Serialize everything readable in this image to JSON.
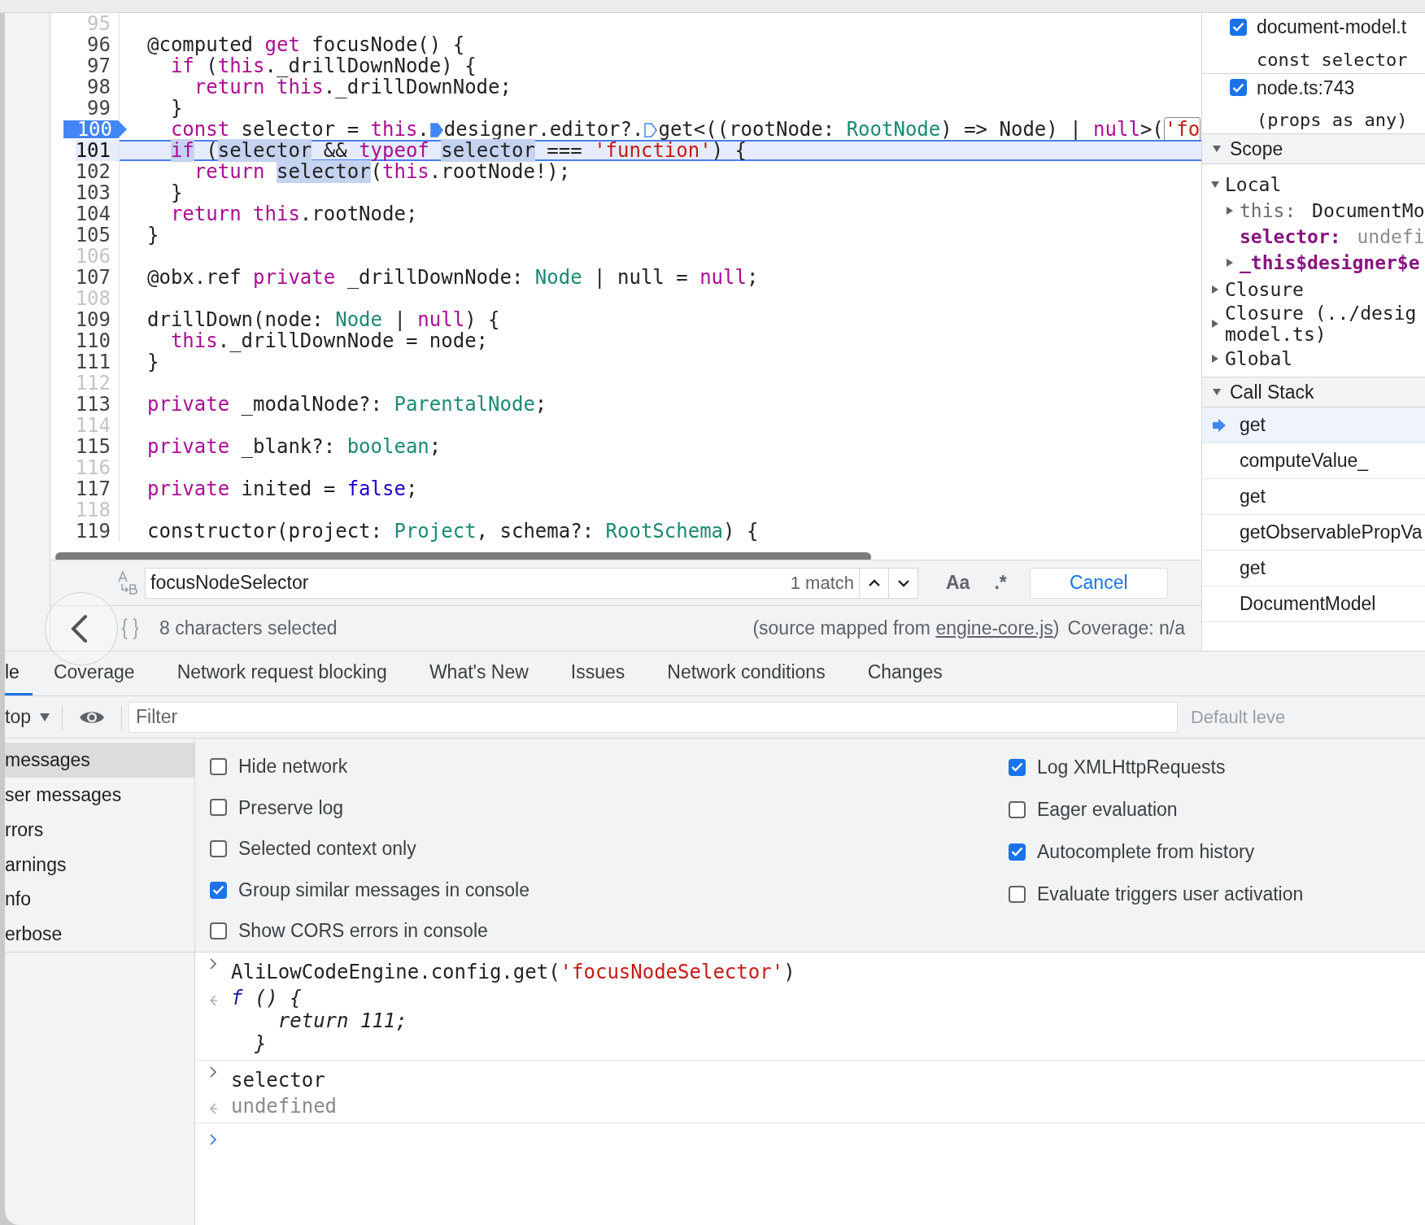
{
  "editor": {
    "lines": [
      {
        "number": "95",
        "breakpoint": false,
        "paused": false
      },
      {
        "number": "96",
        "breakpoint": false,
        "paused": false,
        "tokens": [
          {
            "kind": "plain",
            "text": "@computed",
            "highlighted": false
          },
          {
            "kind": "keyword",
            "text": " get",
            "highlighted": false
          },
          {
            "kind": "plain",
            "text": " focusNode() {",
            "highlighted": false
          }
        ]
      },
      {
        "number": "97",
        "breakpoint": false,
        "paused": false,
        "tokens": [
          {
            "kind": "keyword",
            "text": "  if",
            "highlighted": false
          },
          {
            "kind": "plain",
            "text": " (",
            "highlighted": false
          },
          {
            "kind": "keyword",
            "text": "this",
            "highlighted": false
          },
          {
            "kind": "plain",
            "text": "._drillDownNode) {",
            "highlighted": false
          }
        ]
      },
      {
        "number": "98",
        "breakpoint": false,
        "paused": false,
        "tokens": [
          {
            "kind": "keyword",
            "text": "    return",
            "highlighted": false
          },
          {
            "kind": "keyword",
            "text": " this",
            "highlighted": false
          },
          {
            "kind": "plain",
            "text": "._drillDownNode;",
            "highlighted": false
          }
        ]
      },
      {
        "number": "99",
        "breakpoint": false,
        "paused": false,
        "tokens": [
          {
            "kind": "plain",
            "text": "  }",
            "highlighted": false
          }
        ]
      },
      {
        "number": "100",
        "breakpoint": true,
        "paused": false,
        "tokens": [
          {
            "kind": "keyword",
            "text": "  const",
            "highlighted": false
          },
          {
            "kind": "plain",
            "text": " selector =",
            "highlighted": false
          },
          {
            "kind": "keyword",
            "text": " this",
            "highlighted": false
          },
          {
            "kind": "plain",
            "text": ".",
            "highlighted": false
          },
          {
            "kind": "marker",
            "active": true
          },
          {
            "kind": "plain",
            "text": "designer.editor?.",
            "highlighted": false
          },
          {
            "kind": "marker",
            "active": false
          },
          {
            "kind": "plain",
            "text": "get<((rootNode:",
            "highlighted": false
          },
          {
            "kind": "type",
            "text": " RootNode",
            "highlighted": false
          },
          {
            "kind": "plain",
            "text": ") => Node) |",
            "highlighted": false
          },
          {
            "kind": "keyword",
            "text": " null",
            "highlighted": false
          },
          {
            "kind": "plain",
            "text": ">(",
            "highlighted": false
          },
          {
            "kind": "search_match",
            "text": "'fo",
            "highlighted": false
          }
        ]
      },
      {
        "number": "101",
        "breakpoint": false,
        "paused": true,
        "tokens": [
          {
            "kind": "keyword",
            "text": "  if",
            "highlighted": true
          },
          {
            "kind": "plain",
            "text": " (",
            "highlighted": false
          },
          {
            "kind": "plain",
            "text": "selector",
            "highlighted": true
          },
          {
            "kind": "plain",
            "text": " &&",
            "highlighted": false
          },
          {
            "kind": "keyword",
            "text": " typeof",
            "highlighted": false
          },
          {
            "kind": "plain",
            "text": " selector",
            "highlighted": true
          },
          {
            "kind": "plain",
            "text": " ===",
            "highlighted": false
          },
          {
            "kind": "string",
            "text": " 'function'",
            "highlighted": false
          },
          {
            "kind": "plain",
            "text": ") {",
            "highlighted": false
          }
        ]
      },
      {
        "number": "102",
        "breakpoint": false,
        "paused": false,
        "tokens": [
          {
            "kind": "keyword",
            "text": "    return",
            "highlighted": false
          },
          {
            "kind": "plain",
            "text": " selector",
            "highlighted": true
          },
          {
            "kind": "plain",
            "text": "(",
            "highlighted": false
          },
          {
            "kind": "keyword",
            "text": "this",
            "highlighted": false
          },
          {
            "kind": "plain",
            "text": ".rootNode!);",
            "highlighted": false
          }
        ]
      },
      {
        "number": "103",
        "breakpoint": false,
        "paused": false,
        "tokens": [
          {
            "kind": "plain",
            "text": "  }",
            "highlighted": false
          }
        ]
      },
      {
        "number": "104",
        "breakpoint": false,
        "paused": false,
        "tokens": [
          {
            "kind": "keyword",
            "text": "  return",
            "highlighted": false
          },
          {
            "kind": "keyword",
            "text": " this",
            "highlighted": false
          },
          {
            "kind": "plain",
            "text": ".rootNode;",
            "highlighted": false
          }
        ]
      },
      {
        "number": "105",
        "breakpoint": false,
        "paused": false,
        "tokens": [
          {
            "kind": "plain",
            "text": "}",
            "highlighted": false
          }
        ]
      },
      {
        "number": "106",
        "breakpoint": false,
        "paused": false
      },
      {
        "number": "107",
        "breakpoint": false,
        "paused": false,
        "tokens": [
          {
            "kind": "plain",
            "text": "@obx.ref",
            "highlighted": false
          },
          {
            "kind": "keyword",
            "text": " private",
            "highlighted": false
          },
          {
            "kind": "plain",
            "text": " _drillDownNode:",
            "highlighted": false
          },
          {
            "kind": "type",
            "text": " Node",
            "highlighted": false
          },
          {
            "kind": "plain",
            "text": " | null =",
            "highlighted": false
          },
          {
            "kind": "keyword",
            "text": " null",
            "highlighted": false
          },
          {
            "kind": "plain",
            "text": ";",
            "highlighted": false
          }
        ]
      },
      {
        "number": "108",
        "breakpoint": false,
        "paused": false
      },
      {
        "number": "109",
        "breakpoint": false,
        "paused": false,
        "tokens": [
          {
            "kind": "plain",
            "text": "drillDown(node:",
            "highlighted": false
          },
          {
            "kind": "type",
            "text": " Node",
            "highlighted": false
          },
          {
            "kind": "plain",
            "text": " |",
            "highlighted": false
          },
          {
            "kind": "keyword",
            "text": " null",
            "highlighted": false
          },
          {
            "kind": "plain",
            "text": ") {",
            "highlighted": false
          }
        ]
      },
      {
        "number": "110",
        "breakpoint": false,
        "paused": false,
        "tokens": [
          {
            "kind": "keyword",
            "text": "  this",
            "highlighted": false
          },
          {
            "kind": "plain",
            "text": "._drillDownNode = node;",
            "highlighted": false
          }
        ]
      },
      {
        "number": "111",
        "breakpoint": false,
        "paused": false,
        "tokens": [
          {
            "kind": "plain",
            "text": "}",
            "highlighted": false
          }
        ]
      },
      {
        "number": "112",
        "breakpoint": false,
        "paused": false
      },
      {
        "number": "113",
        "breakpoint": false,
        "paused": false,
        "tokens": [
          {
            "kind": "keyword",
            "text": "private",
            "highlighted": false
          },
          {
            "kind": "plain",
            "text": " _modalNode?:",
            "highlighted": false
          },
          {
            "kind": "type",
            "text": " ParentalNode",
            "highlighted": false
          },
          {
            "kind": "plain",
            "text": ";",
            "highlighted": false
          }
        ]
      },
      {
        "number": "114",
        "breakpoint": false,
        "paused": false
      },
      {
        "number": "115",
        "breakpoint": false,
        "paused": false,
        "tokens": [
          {
            "kind": "keyword",
            "text": "private",
            "highlighted": false
          },
          {
            "kind": "plain",
            "text": " _blank?:",
            "highlighted": false
          },
          {
            "kind": "type",
            "text": " boolean",
            "highlighted": false
          },
          {
            "kind": "plain",
            "text": ";",
            "highlighted": false
          }
        ]
      },
      {
        "number": "116",
        "breakpoint": false,
        "paused": false
      },
      {
        "number": "117",
        "breakpoint": false,
        "paused": false,
        "tokens": [
          {
            "kind": "keyword",
            "text": "private",
            "highlighted": false
          },
          {
            "kind": "plain",
            "text": " inited =",
            "highlighted": false
          },
          {
            "kind": "literal",
            "text": " false",
            "highlighted": false
          },
          {
            "kind": "plain",
            "text": ";",
            "highlighted": false
          }
        ]
      },
      {
        "number": "118",
        "breakpoint": false,
        "paused": false
      },
      {
        "number": "119",
        "breakpoint": false,
        "paused": false,
        "tokens": [
          {
            "kind": "plain",
            "text": "constructor(project:",
            "highlighted": false
          },
          {
            "kind": "type",
            "text": " Project",
            "highlighted": false
          },
          {
            "kind": "plain",
            "text": ", schema?:",
            "highlighted": false
          },
          {
            "kind": "type",
            "text": " RootSchema",
            "highlighted": false
          },
          {
            "kind": "plain",
            "text": ") {",
            "highlighted": false
          }
        ]
      }
    ]
  },
  "search": {
    "value": "focusNodeSelector",
    "match_count": "1 match",
    "case_button": "Aa",
    "regex_button": ".*",
    "cancel": "Cancel"
  },
  "status_bar": {
    "selection": "8 characters selected",
    "source_prefix": "(source mapped from ",
    "source_link": "engine-core.js",
    "source_suffix": ")",
    "coverage": "Coverage: n/a"
  },
  "debugger": {
    "breakpoints": [
      {
        "file": "document-model.t",
        "code": "const selector",
        "checked": true
      },
      {
        "file": "node.ts:743",
        "code": "(props as any)",
        "checked": true
      }
    ],
    "scope": {
      "title": "Scope",
      "expanded": true,
      "groups": [
        {
          "lines": [
            "Local"
          ],
          "expanded": true,
          "children": [
            {
              "kind": "object",
              "name": "this:",
              "value": "DocumentMo"
            },
            {
              "kind": "own_value",
              "name": "selector:",
              "value": "undefi"
            },
            {
              "kind": "own_object",
              "name": "_this$designer$e"
            }
          ]
        },
        {
          "lines": [
            "Closure"
          ],
          "expanded": false
        },
        {
          "lines": [
            "Closure (../desig",
            "model.ts)"
          ],
          "expanded": false
        },
        {
          "lines": [
            "Global"
          ],
          "expanded": false
        }
      ]
    },
    "call_stack": {
      "title": "Call Stack",
      "expanded": true,
      "frames": [
        {
          "label": "get",
          "selected": true
        },
        {
          "label": "computeValue_",
          "selected": false
        },
        {
          "label": "get",
          "selected": false
        },
        {
          "label": "getObservablePropVa",
          "selected": false
        },
        {
          "label": "get",
          "selected": false
        },
        {
          "label": "DocumentModel",
          "selected": false
        }
      ]
    }
  },
  "drawer_tabs": [
    {
      "label": "le",
      "selected": true
    },
    {
      "label": "Coverage",
      "selected": false
    },
    {
      "label": "Network request blocking",
      "selected": false
    },
    {
      "label": "What's New",
      "selected": false
    },
    {
      "label": "Issues",
      "selected": false
    },
    {
      "label": "Network conditions",
      "selected": false
    },
    {
      "label": "Changes",
      "selected": false
    }
  ],
  "console_toolbar": {
    "context": "top",
    "filter_placeholder": "Filter",
    "levels": "Default leve"
  },
  "console_sidebar": [
    {
      "label": "messages",
      "selected": true
    },
    {
      "label": "ser messages",
      "selected": false
    },
    {
      "label": "rrors",
      "selected": false
    },
    {
      "label": "arnings",
      "selected": false
    },
    {
      "label": "nfo",
      "selected": false
    },
    {
      "label": "erbose",
      "selected": false
    }
  ],
  "console_settings": {
    "left": [
      {
        "label": "Hide network",
        "checked": false
      },
      {
        "label": "Preserve log",
        "checked": false
      },
      {
        "label": "Selected context only",
        "checked": false
      },
      {
        "label": "Group similar messages in console",
        "checked": true
      },
      {
        "label": "Show CORS errors in console",
        "checked": false
      }
    ],
    "right": [
      {
        "label": "Log XMLHttpRequests",
        "checked": true
      },
      {
        "label": "Eager evaluation",
        "checked": false
      },
      {
        "label": "Autocomplete from history",
        "checked": true
      },
      {
        "label": "Evaluate triggers user activation",
        "checked": false
      }
    ]
  },
  "console_entries": [
    {
      "input": [
        {
          "kind": "plain",
          "text": "AliLowCodeEngine.config.get("
        },
        {
          "kind": "string",
          "text": "'focusNodeSelector'"
        },
        {
          "kind": "plain",
          "text": ")"
        }
      ],
      "result": {
        "kind": "function",
        "keyword": "f",
        "lines": [
          "() {",
          "  return 111;",
          "}"
        ]
      }
    },
    {
      "input": [
        {
          "kind": "plain",
          "text": "selector"
        }
      ],
      "result": {
        "kind": "undefined",
        "lines": [
          "undefined"
        ]
      }
    }
  ]
}
